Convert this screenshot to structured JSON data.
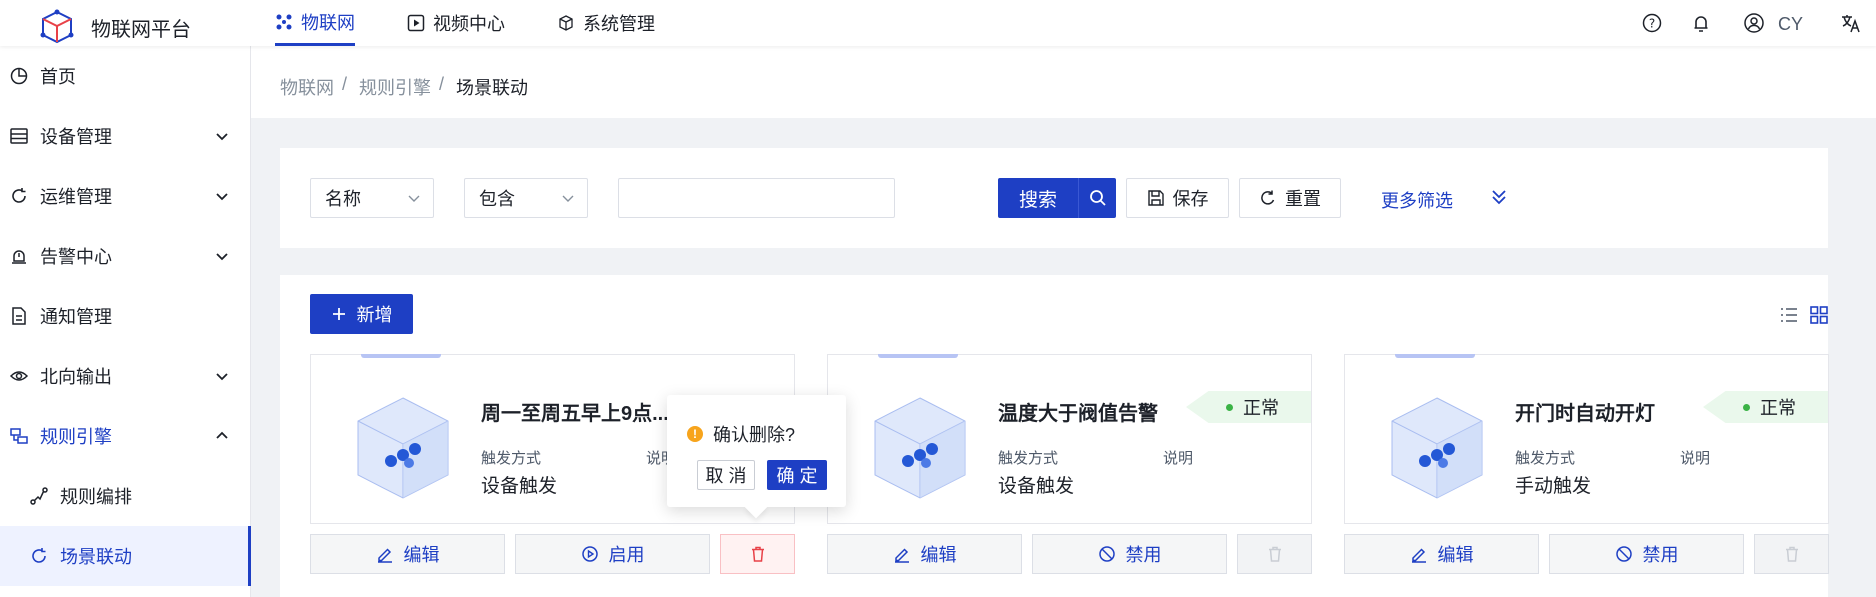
{
  "app": {
    "title": "物联网平台"
  },
  "topnav": [
    {
      "label": "物联网",
      "icon": "iot-icon",
      "active": true
    },
    {
      "label": "视频中心",
      "icon": "play-icon"
    },
    {
      "label": "系统管理",
      "icon": "cube-icon"
    }
  ],
  "user": {
    "name": "CY"
  },
  "sidebar": {
    "items": [
      {
        "label": "首页",
        "icon": "pie-chart-icon"
      },
      {
        "label": "设备管理",
        "icon": "server-icon",
        "expandable": true
      },
      {
        "label": "运维管理",
        "icon": "refresh-icon",
        "expandable": true
      },
      {
        "label": "告警中心",
        "icon": "alarm-icon",
        "expandable": true
      },
      {
        "label": "通知管理",
        "icon": "document-icon"
      },
      {
        "label": "北向输出",
        "icon": "eye-icon",
        "expandable": true
      },
      {
        "label": "规则引擎",
        "icon": "rule-icon",
        "expanded": true
      },
      {
        "label": "规则编排",
        "icon": "flow-icon"
      },
      {
        "label": "场景联动",
        "icon": "scene-icon",
        "selected": true
      }
    ]
  },
  "breadcrumb": [
    "物联网",
    "规则引擎",
    "场景联动"
  ],
  "filter": {
    "field": "名称",
    "operator": "包含",
    "value": "",
    "search_label": "搜索",
    "save_label": "保存",
    "reset_label": "重置",
    "more_label": "更多筛选"
  },
  "toolbar": {
    "add_label": "新增"
  },
  "cards": [
    {
      "name": "周一至周五早上9点...",
      "trigger_key": "触发方式",
      "trigger_value": "设备触发",
      "desc_key": "说明",
      "status": "",
      "actions": [
        "编辑",
        "启用"
      ]
    },
    {
      "name": "温度大于阀值告警",
      "trigger_key": "触发方式",
      "trigger_value": "设备触发",
      "desc_key": "说明",
      "status": "正常",
      "actions": [
        "编辑",
        "禁用"
      ]
    },
    {
      "name": "开门时自动开灯",
      "trigger_key": "触发方式",
      "trigger_value": "手动触发",
      "desc_key": "说明",
      "status": "正常",
      "actions": [
        "编辑",
        "禁用"
      ]
    }
  ],
  "popconfirm": {
    "message": "确认删除?",
    "cancel": "取 消",
    "ok": "确 定"
  },
  "colors": {
    "primary": "#1e3fc4",
    "success": "#3bb346",
    "danger": "#e84148",
    "warning": "#f7a41c"
  }
}
